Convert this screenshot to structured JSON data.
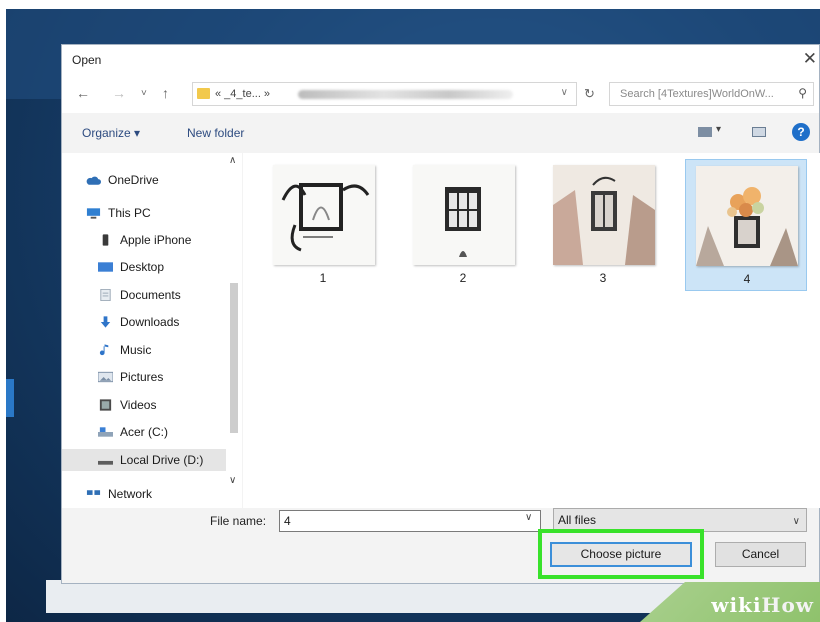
{
  "dialog": {
    "title": "Open",
    "close_glyph": "✕"
  },
  "nav": {
    "back_glyph": "←",
    "forward_glyph": "→",
    "recent_glyph": "˅",
    "up_glyph": "↑",
    "address_text": "«  _4_te...  »",
    "refresh_glyph": "↻",
    "search_placeholder": "Search [4Textures]WorldOnW...",
    "search_glyph": "⚲"
  },
  "toolbar": {
    "organize_label": "Organize ▾",
    "new_folder_label": "New folder",
    "help_glyph": "?"
  },
  "sidebar": {
    "items": [
      {
        "label": "OneDrive",
        "icon": "cloud-icon",
        "color": "#2f6fb5"
      },
      {
        "label": "This PC",
        "icon": "computer-icon",
        "color": "#2f7fd1"
      },
      {
        "label": "Apple iPhone",
        "icon": "phone-icon",
        "color": "#3a3a3a"
      },
      {
        "label": "Desktop",
        "icon": "desktop-icon",
        "color": "#3b7fd4"
      },
      {
        "label": "Documents",
        "icon": "documents-icon",
        "color": "#9aa7b5"
      },
      {
        "label": "Downloads",
        "icon": "download-icon",
        "color": "#2f75c9"
      },
      {
        "label": "Music",
        "icon": "music-icon",
        "color": "#2f75c9"
      },
      {
        "label": "Pictures",
        "icon": "pictures-icon",
        "color": "#7a8ea5"
      },
      {
        "label": "Videos",
        "icon": "videos-icon",
        "color": "#4a4a4a"
      },
      {
        "label": "Acer (C:)",
        "icon": "drive-icon",
        "color": "#8fa3b8"
      },
      {
        "label": "Local Drive (D:)",
        "icon": "drive-icon",
        "color": "#5d5d5d"
      },
      {
        "label": "Network",
        "icon": "network-icon",
        "color": "#2f6fb5"
      }
    ],
    "selected_index": 10
  },
  "files": [
    {
      "label": "1",
      "selected": false
    },
    {
      "label": "2",
      "selected": false
    },
    {
      "label": "3",
      "selected": false
    },
    {
      "label": "4",
      "selected": true
    }
  ],
  "footer": {
    "file_name_label": "File name:",
    "file_name_value": "4",
    "filter_value": "All files",
    "choose_label": "Choose picture",
    "cancel_label": "Cancel"
  },
  "watermark": {
    "text": "wikiHow"
  },
  "colors": {
    "highlight": "#39e22b",
    "selection": "#cce4f7",
    "accent_blue": "#1f6fc9"
  }
}
